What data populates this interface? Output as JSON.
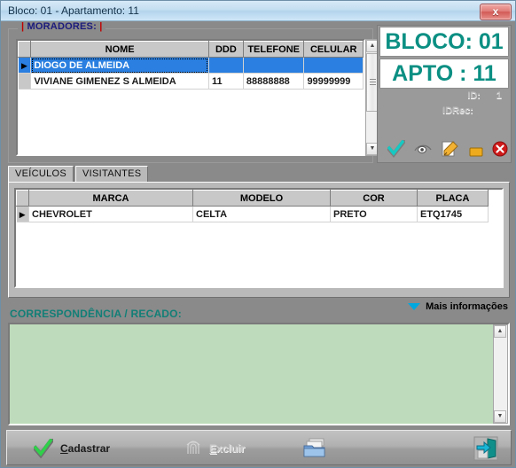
{
  "window": {
    "title": "Bloco: 01 - Apartamento: 11",
    "close_label": "x"
  },
  "residents_group": {
    "legend_prefix": "|",
    "legend": "MORADORES:",
    "legend_suffix": "|",
    "columns": [
      "NOME",
      "DDD",
      "TELEFONE",
      "CELULAR"
    ],
    "rows": [
      {
        "selected": true,
        "marker": "▶",
        "nome": "DIOGO DE ALMEIDA",
        "ddd": "",
        "telefone": "",
        "celular": ""
      },
      {
        "selected": false,
        "marker": "",
        "nome": "VIVIANE GIMENEZ S ALMEIDA",
        "ddd": "11",
        "telefone": "88888888",
        "celular": "99999999"
      }
    ]
  },
  "info_panel": {
    "bloco_label": "BLOCO: 01",
    "apto_label": "APTO : 11",
    "id_label": "ID:",
    "id_value": "1",
    "idrec_label": "IDRec:",
    "accent_color": "#0b8f83",
    "icons": [
      {
        "name": "check-icon",
        "title": "Confirmar"
      },
      {
        "name": "eye-icon",
        "title": "Visualizar"
      },
      {
        "name": "edit-icon",
        "title": "Editar"
      },
      {
        "name": "unlock-icon",
        "title": "Desbloquear"
      },
      {
        "name": "cancel-icon",
        "title": "Cancelar"
      }
    ]
  },
  "tabs": [
    {
      "label": "VEÍCULOS",
      "active": true
    },
    {
      "label": "VISITANTES",
      "active": false
    }
  ],
  "vehicles": {
    "columns": [
      "MARCA",
      "MODELO",
      "COR",
      "PLACA"
    ],
    "rows": [
      {
        "marker": "▶",
        "marca": "CHEVROLET",
        "modelo": "CELTA",
        "cor": "PRETO",
        "placa": "ETQ1745"
      }
    ]
  },
  "more_info": {
    "label": "Mais informações",
    "triangle_color": "#00a8e0"
  },
  "correspondence": {
    "label": "CORRESPONDÊNCIA / RECADO:",
    "value": "",
    "background": "#bedcbb",
    "label_color": "#127f77"
  },
  "toolbar": {
    "buttons": [
      {
        "name": "cadastrar",
        "label_pre": "",
        "label_accel": "C",
        "label_post": "adastrar",
        "enabled": true,
        "icon": "check-icon"
      },
      {
        "name": "excluir",
        "label_pre": "",
        "label_accel": "E",
        "label_post": "xcluir",
        "enabled": false,
        "icon": "fingerprint-icon"
      },
      {
        "name": "pasta",
        "label_pre": "",
        "label_accel": "",
        "label_post": "",
        "enabled": true,
        "icon": "folder-icon"
      },
      {
        "name": "sair",
        "label_pre": "",
        "label_accel": "",
        "label_post": "",
        "enabled": true,
        "icon": "exit-door-icon"
      }
    ]
  }
}
